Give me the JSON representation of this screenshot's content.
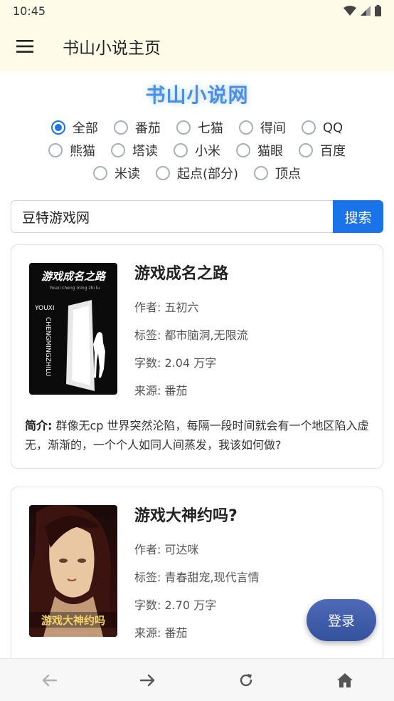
{
  "status_bar": {
    "time": "10:45"
  },
  "app_bar": {
    "title": "书山小说主页"
  },
  "site_title": "书山小说网",
  "sources": {
    "row1": [
      "全部",
      "番茄",
      "七猫",
      "得间",
      "QQ"
    ],
    "row2": [
      "熊猫",
      "塔读",
      "小米",
      "猫眼",
      "百度"
    ],
    "row3": [
      "米读",
      "起点(部分)",
      "顶点"
    ],
    "selected": "全部"
  },
  "search": {
    "value": "豆特游戏网",
    "button_label": "搜索"
  },
  "books": [
    {
      "title": "游戏成名之路",
      "author": "作者: 五初六",
      "tags": "标签: 都市脑洞,无限流",
      "words": "字数: 2.04 万字",
      "source": "来源: 番茄",
      "intro_label": "简介:",
      "intro": " 群像无cp 世界突然沦陷，每隔一段时间就会有一个地区陷入虚无，渐渐的，一个个人如同人间蒸发，我该如何做?",
      "cover_text": {
        "title": "游戏成名之路",
        "pinyin": "Youxi cheng ming zhi lu",
        "side": "YOUXI CHENGMINGZHILU"
      }
    },
    {
      "title": "游戏大神约吗?",
      "author": "作者: 可达咪",
      "tags": "标签: 青春甜宠,现代言情",
      "words": "字数: 2.70 万字",
      "source": "来源: 番茄",
      "cover_text": {
        "title": "游戏大神约吗"
      }
    }
  ],
  "login_label": "登录",
  "colors": {
    "accent": "#1a73e8",
    "header_bg": "#fefbe8",
    "login_bg": "#3d5aa8",
    "site_title": "#4a8fe0"
  },
  "icons": [
    "menu-icon",
    "wifi-icon",
    "signal-icon",
    "battery-icon",
    "back-arrow-icon",
    "forward-arrow-icon",
    "refresh-icon",
    "home-icon"
  ]
}
